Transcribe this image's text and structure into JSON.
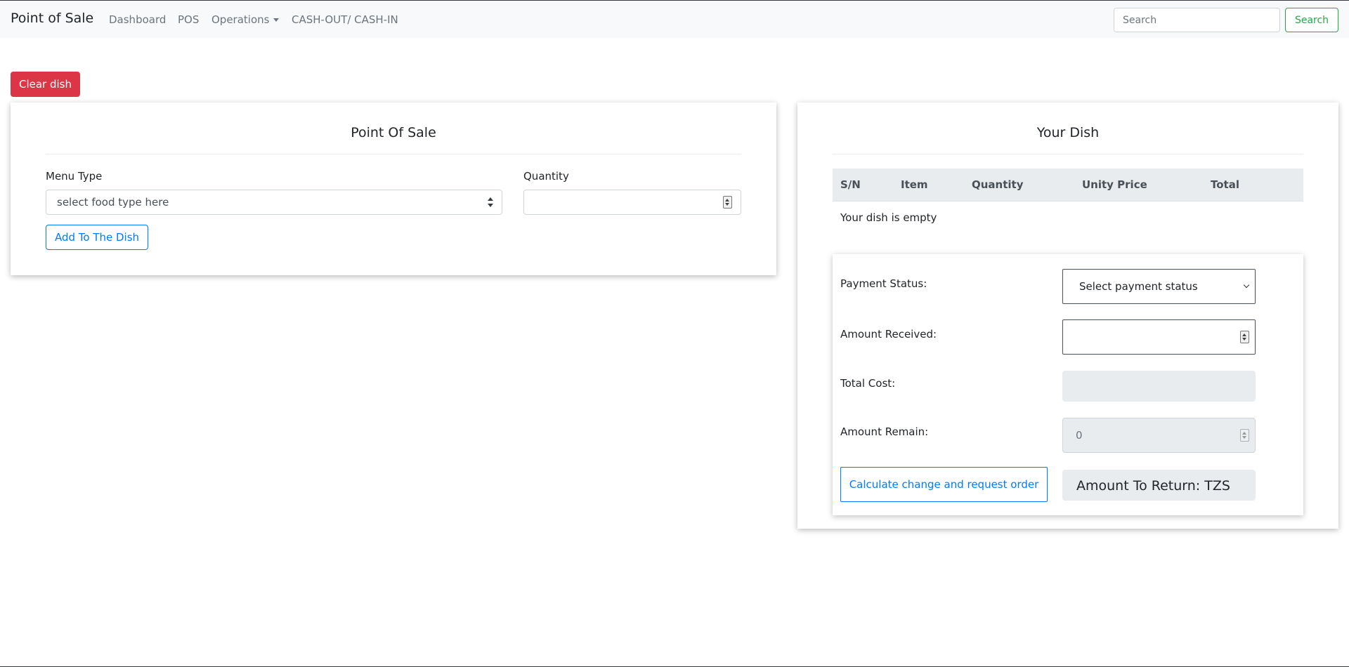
{
  "navbar": {
    "brand": "Point of Sale",
    "links": [
      {
        "label": "Dashboard"
      },
      {
        "label": "POS"
      },
      {
        "label": "Operations"
      },
      {
        "label": "CASH-OUT/ CASH-IN"
      }
    ],
    "search_placeholder": "Search",
    "search_button": "Search"
  },
  "clear_button": "Clear dish",
  "pos_card": {
    "title": "Point Of Sale",
    "menu_type_label": "Menu Type",
    "menu_type_value": "select food type here",
    "quantity_label": "Quantity",
    "add_button": "Add To The Dish"
  },
  "dish_card": {
    "title": "Your Dish",
    "columns": [
      "S/N",
      "Item",
      "Quantity",
      "Unity Price",
      "Total"
    ],
    "empty_message": "Your dish is empty",
    "payment": {
      "status_label": "Payment Status:",
      "status_value": "Select payment status",
      "amount_received_label": "Amount Received:",
      "total_cost_label": "Total Cost:",
      "amount_remain_label": "Amount Remain:",
      "amount_remain_value": "0",
      "calculate_button": "Calculate change and request order",
      "amount_to_return": "Amount To Return: TZS"
    }
  },
  "colors": {
    "danger": "#dc3545",
    "primary": "#007bff",
    "success": "#28a745",
    "navbar_bg": "#f8f9fa"
  }
}
